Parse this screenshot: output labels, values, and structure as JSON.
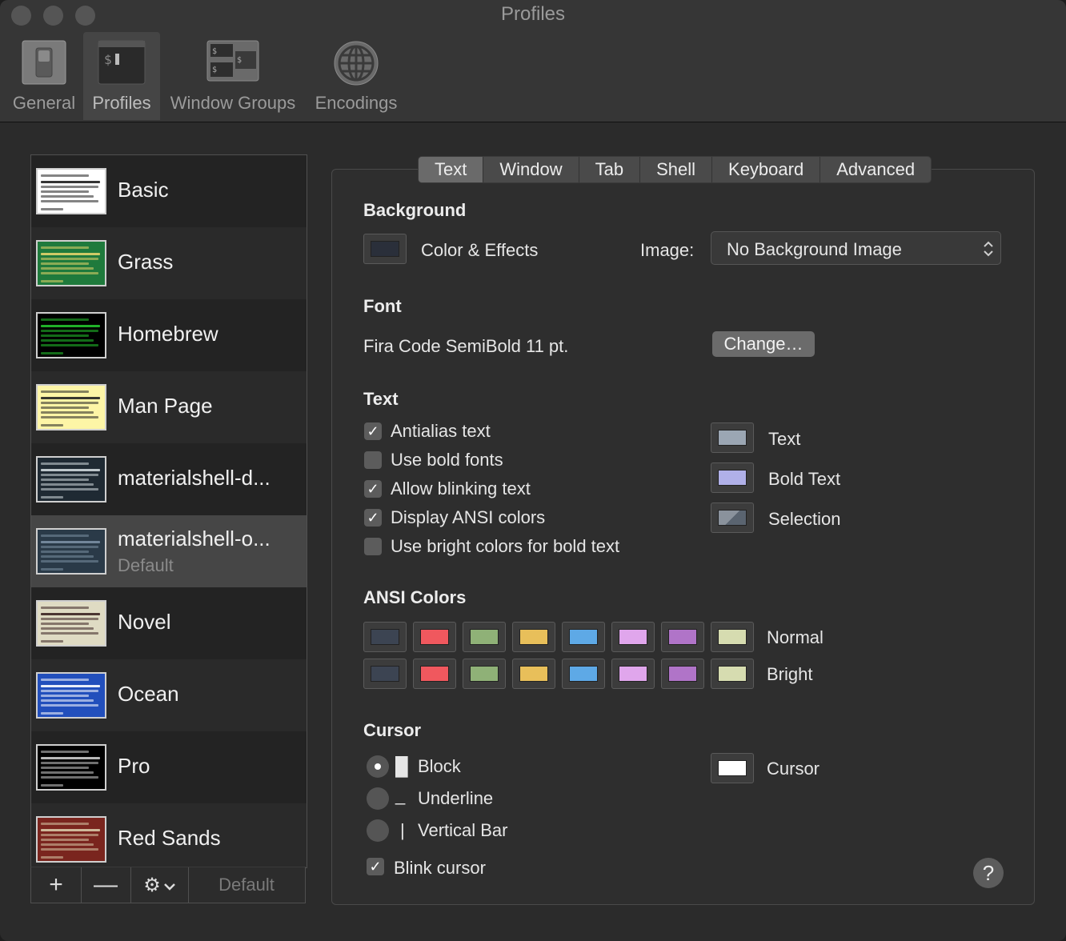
{
  "window": {
    "title": "Profiles"
  },
  "toolbar": {
    "items": [
      {
        "label": "General",
        "icon": "switch-icon"
      },
      {
        "label": "Profiles",
        "icon": "terminal-icon"
      },
      {
        "label": "Window Groups",
        "icon": "window-groups-icon"
      },
      {
        "label": "Encodings",
        "icon": "globe-icon"
      }
    ],
    "active": "Profiles"
  },
  "profiles": {
    "items": [
      {
        "name": "Basic",
        "bg": "#ffffff",
        "accent": "#1f1f1f"
      },
      {
        "name": "Grass",
        "bg": "#1f7a3c",
        "accent": "#e2d36a"
      },
      {
        "name": "Homebrew",
        "bg": "#000000",
        "accent": "#23c32c"
      },
      {
        "name": "Man Page",
        "bg": "#fdf5a6",
        "accent": "#222222"
      },
      {
        "name": "materialshell-d...",
        "bg": "#1f2a33",
        "accent": "#cfd8dc"
      },
      {
        "name": "materialshell-o...",
        "sub": "Default",
        "bg": "#2a3a48",
        "accent": "#7a8fa3"
      },
      {
        "name": "Novel",
        "bg": "#dfdbc3",
        "accent": "#3b2322"
      },
      {
        "name": "Ocean",
        "bg": "#224fbc",
        "accent": "#ffffff"
      },
      {
        "name": "Pro",
        "bg": "#000000",
        "accent": "#cccccc"
      },
      {
        "name": "Red Sands",
        "bg": "#7a251e",
        "accent": "#d7c9a7"
      }
    ],
    "selected_index": 5,
    "bottom": {
      "add": "+",
      "remove": "—",
      "gear": "⚙",
      "default_label": "Default"
    }
  },
  "tabs": {
    "labels": [
      "Text",
      "Window",
      "Tab",
      "Shell",
      "Keyboard",
      "Advanced"
    ],
    "active": "Text"
  },
  "background": {
    "heading": "Background",
    "color_effects_label": "Color & Effects",
    "color": "#2a2f3a",
    "image_label": "Image:",
    "image_value": "No Background Image"
  },
  "font": {
    "heading": "Font",
    "value": "Fira Code SemiBold 11 pt.",
    "change_label": "Change…"
  },
  "text": {
    "heading": "Text",
    "options": [
      {
        "label": "Antialias text",
        "checked": true
      },
      {
        "label": "Use bold fonts",
        "checked": false
      },
      {
        "label": "Allow blinking text",
        "checked": true
      },
      {
        "label": "Display ANSI colors",
        "checked": true
      },
      {
        "label": "Use bright colors for bold text",
        "checked": false
      }
    ],
    "colors": [
      {
        "label": "Text",
        "color": "#9ba6b3"
      },
      {
        "label": "Bold Text",
        "color": "#b0b0e8"
      },
      {
        "label": "Selection",
        "color": "#5a6470"
      }
    ]
  },
  "ansi": {
    "heading": "ANSI Colors",
    "normal_label": "Normal",
    "bright_label": "Bright",
    "normal": [
      "#3c4452",
      "#f0585e",
      "#8fb177",
      "#e8bf5a",
      "#5ea9e6",
      "#e0a6ec",
      "#b074c8",
      "#d6dcb0"
    ],
    "bright": [
      "#3c4452",
      "#f0585e",
      "#8fb177",
      "#e8bf5a",
      "#5ea9e6",
      "#e0a6ec",
      "#b074c8",
      "#d6dcb0"
    ]
  },
  "cursor": {
    "heading": "Cursor",
    "options": [
      {
        "label": "Block",
        "glyph": "█",
        "selected": true
      },
      {
        "label": "Underline",
        "glyph": "_",
        "selected": false
      },
      {
        "label": "Vertical Bar",
        "glyph": "|",
        "selected": false
      }
    ],
    "blink_label": "Blink cursor",
    "blink_checked": true,
    "color_label": "Cursor",
    "color": "#ffffff"
  },
  "help": {
    "label": "?"
  }
}
